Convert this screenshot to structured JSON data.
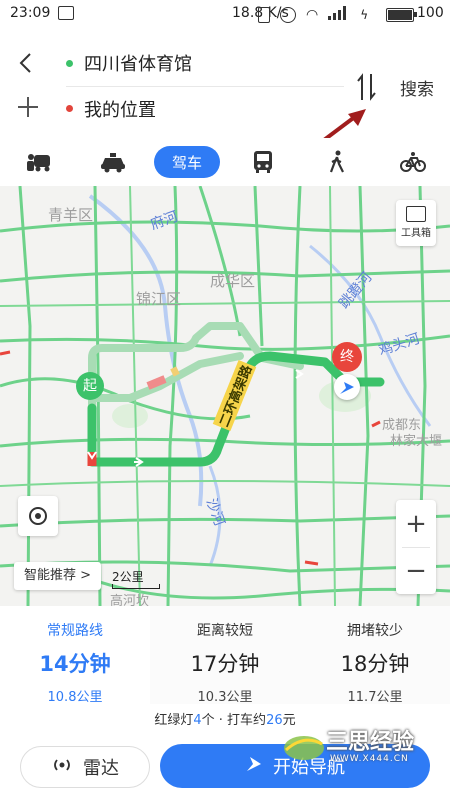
{
  "status_bar": {
    "time": "23:09",
    "net_speed": "18.8 K/s",
    "battery": "100"
  },
  "header": {
    "origin": "四川省体育馆",
    "destination": "我的位置",
    "search_label": "搜索",
    "back_icon": "chevron-left-icon",
    "add_icon": "plus-icon",
    "swap_icon": "swap-vertical-icon"
  },
  "modes": {
    "items": [
      {
        "icon": "taxi-share-icon"
      },
      {
        "icon": "taxi-icon"
      },
      {
        "label": "驾车",
        "active": true
      },
      {
        "icon": "bus-icon"
      },
      {
        "icon": "walk-icon"
      },
      {
        "icon": "bike-icon"
      }
    ]
  },
  "map": {
    "labels": {
      "qingyang": "青羊区",
      "fuhe": "府河",
      "chenghua": "成华区",
      "jinjiang": "锦江区",
      "tiaodeng_river": "跳蹬河",
      "jitou_river": "鸡头河",
      "ring_road": "二环高架路",
      "chengdu_east": "成都东",
      "linjia": "林家大堰",
      "sha_river": "沙河",
      "gaohe": "高河坎"
    },
    "toolbox_label": "工具箱",
    "start_marker": "起",
    "end_marker": "终",
    "smart_recommend": "智能推荐 >",
    "scale": "2公里",
    "zoom_in": "+",
    "zoom_out": "−",
    "colors": {
      "route_main": "#3cc26a",
      "route_alt": "#a8dcb5",
      "congestion": "#e8453c",
      "slow": "#f2b33a",
      "road": "#6dd28a",
      "accent": "#2f7bf5"
    }
  },
  "routes": [
    {
      "name": "常规路线",
      "time": "14分钟",
      "distance": "10.8公里",
      "selected": true
    },
    {
      "name": "距离较短",
      "time": "17分钟",
      "distance": "10.3公里",
      "selected": false
    },
    {
      "name": "拥堵较少",
      "time": "18分钟",
      "distance": "11.7公里",
      "selected": false
    }
  ],
  "summary": {
    "prefix": "红绿灯",
    "lights": "4",
    "middle": "个 · 打车约",
    "fare": "26",
    "suffix": "元"
  },
  "bottom": {
    "radar_label": "雷达",
    "start_label": "开始导航"
  },
  "watermark": {
    "text": "三思经验",
    "url": "WWW.X444.CN"
  }
}
